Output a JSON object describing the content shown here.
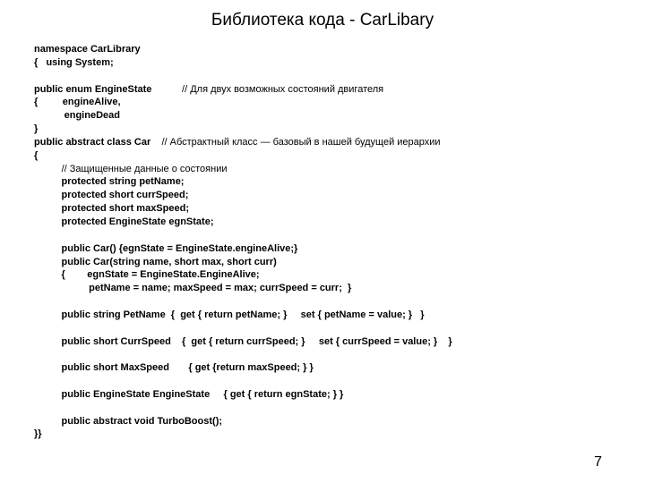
{
  "title": "Библиотека кода - CarLibary",
  "page_number": "7",
  "code": {
    "l01": "namespace CarLibrary",
    "l02": "{   using System;",
    "l03": "",
    "l04a": "public enum EngineState           ",
    "l04b": "// Для двух возможных состояний двигателя",
    "l05": "{         engineAlive,",
    "l06": "           engineDead",
    "l07": "}",
    "l08a": "public abstract class Car    ",
    "l08b": "// Абстрактный класс — базовый в нашей будущей иерархии",
    "l09": "{",
    "l10a": "          ",
    "l10b": "// Защищенные данные о состоянии",
    "l11": "          protected string petName;",
    "l12": "          protected short currSpeed;",
    "l13": "          protected short maxSpeed;",
    "l14": "          protected EngineState egnState;",
    "l15": "",
    "l16": "          public Car() {egnState = EngineState.engineAlive;}",
    "l17": "          public Car(string name, short max, short curr)",
    "l18": "          {        egnState = EngineState.EngineAlive;",
    "l19": "                    petName = name; maxSpeed = max; currSpeed = curr;  }",
    "l20": "",
    "l21": "          public string PetName  {  get { return petName; }     set { petName = value; }   }",
    "l22": "",
    "l23": "          public short CurrSpeed    {  get { return currSpeed; }     set { currSpeed = value; }    }",
    "l24": "",
    "l25": "          public short MaxSpeed       { get {return maxSpeed; } }",
    "l26": "",
    "l27": "          public EngineState EngineState     { get { return egnState; } }",
    "l28": "",
    "l29": "          public abstract void TurboBoost();",
    "l30": "}}"
  }
}
